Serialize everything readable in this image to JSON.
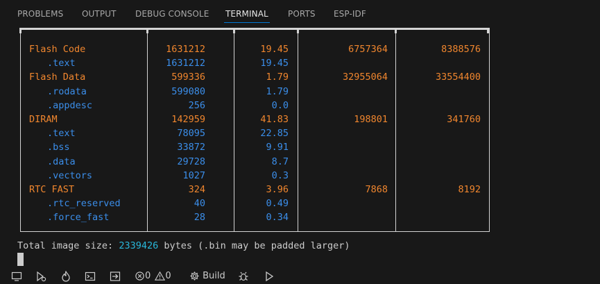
{
  "panel_tabs": [
    "PROBLEMS",
    "OUTPUT",
    "DEBUG CONSOLE",
    "TERMINAL",
    "PORTS",
    "ESP-IDF"
  ],
  "active_tab": "TERMINAL",
  "rows": [
    {
      "name": "Flash Code",
      "kind": "region",
      "used": "1631212",
      "pct": "19.45",
      "remain": "6757364",
      "total": "8388576"
    },
    {
      "name": ".text",
      "kind": "section",
      "used": "1631212",
      "pct": "19.45",
      "remain": "",
      "total": ""
    },
    {
      "name": "Flash Data",
      "kind": "region",
      "used": "599336",
      "pct": "1.79",
      "remain": "32955064",
      "total": "33554400"
    },
    {
      "name": ".rodata",
      "kind": "section",
      "used": "599080",
      "pct": "1.79",
      "remain": "",
      "total": ""
    },
    {
      "name": ".appdesc",
      "kind": "section",
      "used": "256",
      "pct": "0.0",
      "remain": "",
      "total": ""
    },
    {
      "name": "DIRAM",
      "kind": "region",
      "used": "142959",
      "pct": "41.83",
      "remain": "198801",
      "total": "341760"
    },
    {
      "name": ".text",
      "kind": "section",
      "used": "78095",
      "pct": "22.85",
      "remain": "",
      "total": ""
    },
    {
      "name": ".bss",
      "kind": "section",
      "used": "33872",
      "pct": "9.91",
      "remain": "",
      "total": ""
    },
    {
      "name": ".data",
      "kind": "section",
      "used": "29728",
      "pct": "8.7",
      "remain": "",
      "total": ""
    },
    {
      "name": ".vectors",
      "kind": "section",
      "used": "1027",
      "pct": "0.3",
      "remain": "",
      "total": ""
    },
    {
      "name": "RTC FAST",
      "kind": "region",
      "used": "324",
      "pct": "3.96",
      "remain": "7868",
      "total": "8192"
    },
    {
      "name": ".rtc_reserved",
      "kind": "section",
      "used": "40",
      "pct": "0.49",
      "remain": "",
      "total": ""
    },
    {
      "name": ".force_fast",
      "kind": "section",
      "used": "28",
      "pct": "0.34",
      "remain": "",
      "total": ""
    }
  ],
  "total_line": {
    "prefix": "Total image size: ",
    "value": "2339426",
    "suffix": " bytes (.bin may be padded larger)"
  },
  "statusbar": {
    "errors": "0",
    "warnings": "0",
    "build_label": "Build"
  },
  "colors": {
    "background": "#181818",
    "region": "#f0862e",
    "section": "#3b8eea",
    "accent": "#0078d4",
    "highlight": "#29b8db"
  },
  "icons": [
    "remote-window-icon",
    "run-debug-icon",
    "flame-icon",
    "terminal-icon",
    "export-icon",
    "error-icon",
    "warning-icon",
    "gear-icon",
    "bug-icon",
    "play-icon"
  ]
}
